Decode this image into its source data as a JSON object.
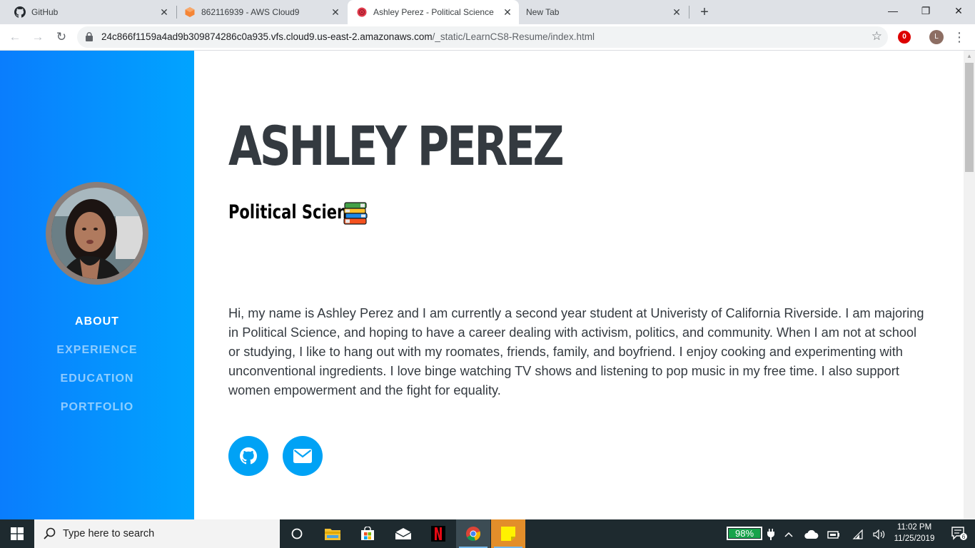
{
  "browser": {
    "tabs": [
      {
        "title": "GitHub",
        "icon": "github-icon"
      },
      {
        "title": "862116939 - AWS Cloud9",
        "icon": "aws-cloud9-icon"
      },
      {
        "title": "Ashley Perez - Political Science",
        "icon": "rose-icon",
        "active": true
      },
      {
        "title": "New Tab",
        "icon": ""
      }
    ],
    "new_tab_symbol": "+",
    "close_symbol": "✕",
    "window_controls": {
      "minimize": "—",
      "restore": "❐",
      "close": "✕"
    },
    "url_host": "24c866f1159a4ad9b309874286c0a935.vfs.cloud9.us-east-2.amazonaws.com",
    "url_path": "/_static/LearnCS8-Resume/index.html",
    "profile_initial": "L",
    "extension_label": "0"
  },
  "sidebar": {
    "nav": [
      {
        "label": "About",
        "active": true
      },
      {
        "label": "Experience",
        "active": false
      },
      {
        "label": "Education",
        "active": false
      },
      {
        "label": "Portfolio",
        "active": false
      }
    ]
  },
  "main": {
    "name": "ASHLEY PEREZ",
    "subtitle": "Political Science",
    "subtitle_emoji": "books-icon",
    "bio": "Hi, my name is Ashley Perez and I am currently a second year student at Univeristy of California Riverside. I am majoring in Political Science, and hoping to have a career dealing with activism, politics, and community. When I am not at school or studying, I like to hang out with my roomates, friends, family, and boyfriend. I enjoy cooking and experimenting with unconventional ingredients. I love binge watching TV shows and listening to pop music in my free time. I also support women empowerment and the fight for equality.",
    "social": [
      {
        "name": "github-button",
        "icon": "github-icon"
      },
      {
        "name": "email-button",
        "icon": "envelope-icon"
      }
    ]
  },
  "taskbar": {
    "search_placeholder": "Type here to search",
    "battery_percent": "98%",
    "time": "11:02 PM",
    "date": "11/25/2019",
    "notification_count": "6"
  },
  "colors": {
    "sidebar_start": "#0a7dfd",
    "sidebar_end": "#01a4ff",
    "accent": "#00a2f5",
    "heading": "#343a40"
  }
}
